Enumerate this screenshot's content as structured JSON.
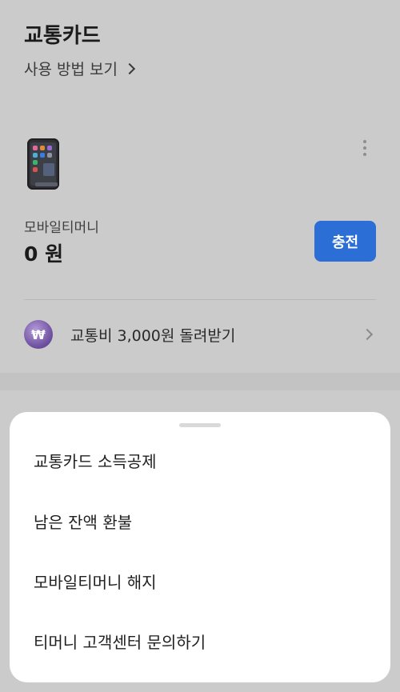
{
  "header": {
    "title": "교통카드",
    "howto_label": "사용 방법 보기"
  },
  "card": {
    "device_icon": "mobile-phone-icon",
    "more_icon": "more-vertical-icon",
    "balance_label": "모바일티머니",
    "balance_amount": "0 원",
    "charge_label": "충전"
  },
  "promo": {
    "icon": "cashback-badge-icon",
    "icon_glyph": "₩",
    "text": "교통비 3,000원 돌려받기"
  },
  "sheet": {
    "items": [
      {
        "label": "교통카드 소득공제"
      },
      {
        "label": "남은 잔액 환불"
      },
      {
        "label": "모바일티머니 해지"
      },
      {
        "label": "티머니 고객센터 문의하기"
      }
    ]
  },
  "colors": {
    "accent": "#2b6fd6",
    "overlay_bg": "#cbcbcb",
    "sheet_bg": "#ffffff"
  }
}
